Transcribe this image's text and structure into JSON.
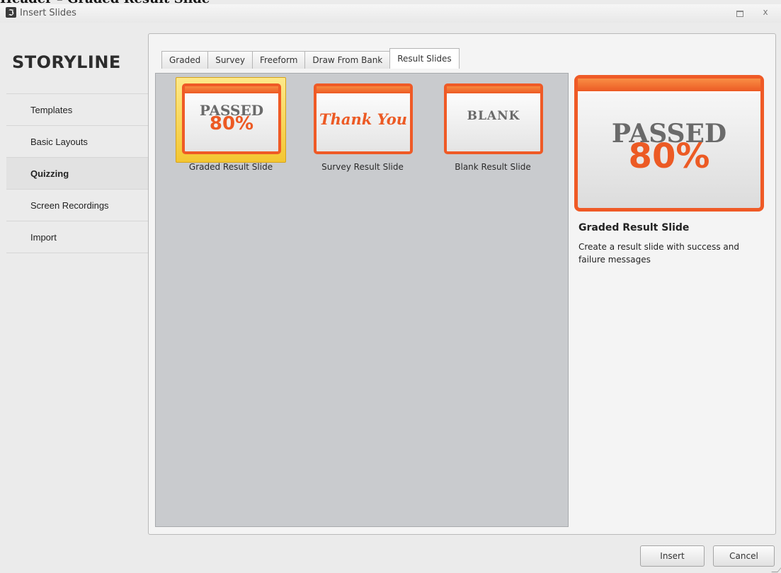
{
  "page_heading": "Header – Graded Result Slide ",
  "window": {
    "title": "Insert Slides",
    "minimize_label": "",
    "close_label": "x"
  },
  "sidebar": {
    "brand": "STORYLINE",
    "items": [
      {
        "label": "Templates"
      },
      {
        "label": "Basic Layouts"
      },
      {
        "label": "Quizzing",
        "active": true
      },
      {
        "label": "Screen Recordings"
      },
      {
        "label": "Import"
      }
    ]
  },
  "tabs": [
    {
      "label": "Graded"
    },
    {
      "label": "Survey"
    },
    {
      "label": "Freeform"
    },
    {
      "label": "Draw From Bank"
    },
    {
      "label": "Result Slides",
      "selected": true
    }
  ],
  "gallery": [
    {
      "label": "Graded Result Slide",
      "line1": "PASSED",
      "line2": "80%",
      "selected": true
    },
    {
      "label": "Survey Result Slide",
      "text": "Thank You"
    },
    {
      "label": "Blank Result Slide",
      "text": "BLANK"
    }
  ],
  "preview": {
    "line1": "PASSED",
    "line2": "80%",
    "title": "Graded Result Slide",
    "description": "Create a result slide with success and failure messages"
  },
  "buttons": {
    "insert": "Insert",
    "cancel": "Cancel"
  },
  "colors": {
    "accent": "#ec5a24",
    "selection": "#f3c632"
  }
}
